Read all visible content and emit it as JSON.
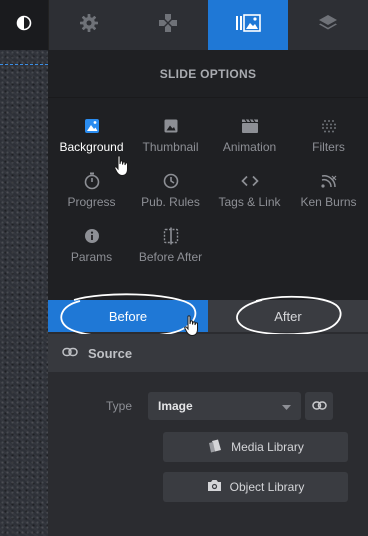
{
  "toolbar": {
    "tabs": [
      {
        "icon": "contrast-icon"
      },
      {
        "icon": "gear-icon"
      },
      {
        "icon": "gamepad-icon"
      },
      {
        "icon": "slides-icon",
        "active": true
      },
      {
        "icon": "layers-icon"
      }
    ],
    "accent_color": "#1f78d6"
  },
  "panel": {
    "title": "SLIDE OPTIONS",
    "options": [
      {
        "label": "Background",
        "icon": "image-icon",
        "active": true
      },
      {
        "label": "Thumbnail",
        "icon": "thumbnail-icon"
      },
      {
        "label": "Animation",
        "icon": "clapperboard-icon"
      },
      {
        "label": "Filters",
        "icon": "filters-icon"
      },
      {
        "label": "Progress",
        "icon": "stopwatch-icon"
      },
      {
        "label": "Pub. Rules",
        "icon": "clock-icon"
      },
      {
        "label": "Tags & Link",
        "icon": "code-icon"
      },
      {
        "label": "Ken Burns",
        "icon": "ken-burns-icon"
      },
      {
        "label": "Params",
        "icon": "info-icon"
      },
      {
        "label": "Before After",
        "icon": "before-after-icon"
      }
    ],
    "before_after": {
      "before_label": "Before",
      "after_label": "After",
      "selected": "Before"
    },
    "source": {
      "title": "Source",
      "type_label": "Type",
      "type_value": "Image",
      "media_library_label": "Media Library",
      "object_library_label": "Object Library"
    }
  }
}
